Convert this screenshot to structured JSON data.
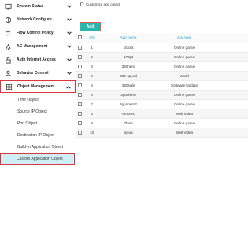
{
  "sidebar": {
    "menu": [
      {
        "label": "System Status",
        "icon": "monitor-icon",
        "expanded": false
      },
      {
        "label": "Network Configure",
        "icon": "network-icon",
        "expanded": false
      },
      {
        "label": "Flow Control Policy",
        "icon": "flow-icon",
        "expanded": false
      },
      {
        "label": "AC Management",
        "icon": "ac-icon",
        "expanded": false
      },
      {
        "label": "Auth Internet Access",
        "icon": "auth-icon",
        "expanded": false
      },
      {
        "label": "Behavior Control",
        "icon": "behavior-icon",
        "expanded": false
      },
      {
        "label": "Object Management",
        "icon": "object-icon",
        "expanded": true
      }
    ],
    "submenu": [
      "Time Object",
      "Source IP Object",
      "Port Object",
      "Destination IP Object",
      "Build-in Application Object",
      "Custom Application Object"
    ],
    "selected_sub": "Custom Application Object"
  },
  "breadcrumb": {
    "text": "Customize app object"
  },
  "toolbar": {
    "add_label": "Add"
  },
  "table": {
    "headers": {
      "sn": "SN",
      "name": "App name",
      "type": "App type"
    },
    "rows": [
      {
        "sn": "1",
        "name": "1fdota",
        "type": "Online game"
      },
      {
        "sn": "2",
        "name": "17Spt",
        "type": "Online game"
      },
      {
        "sn": "3",
        "name": "360hero",
        "type": "Online game"
      },
      {
        "sn": "4",
        "name": "360-speed",
        "type": "Model"
      },
      {
        "sn": "5",
        "name": "360safe",
        "type": "Software Update"
      },
      {
        "sn": "6",
        "name": "3guohero",
        "type": "Online game"
      },
      {
        "sn": "7",
        "name": "3guohero2",
        "type": "Online game"
      },
      {
        "sn": "8",
        "name": "6rooms",
        "type": "Web Video"
      },
      {
        "sn": "9",
        "name": "7fanv",
        "type": "Online game"
      },
      {
        "sn": "10",
        "name": "acfun",
        "type": "Web Video"
      }
    ]
  },
  "colors": {
    "accent": "#2bb6ad",
    "header_text": "#23a3c8",
    "highlight_border": "#d9363e",
    "selected_bg": "#cfeff7"
  }
}
